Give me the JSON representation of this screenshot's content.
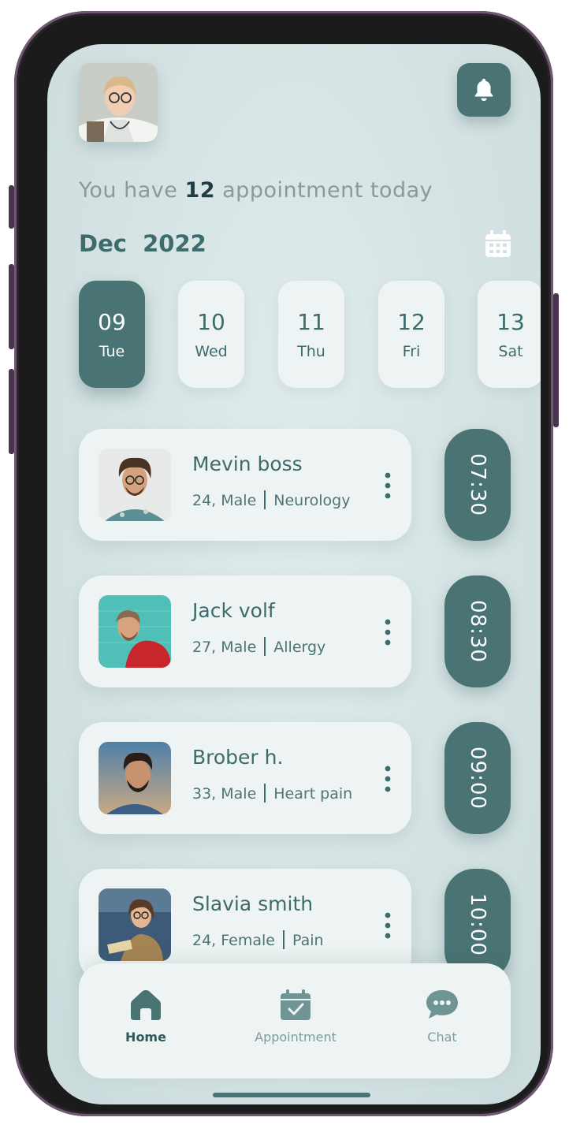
{
  "header": {
    "avatar_label": "doctor avatar",
    "greeting_prefix": "You have",
    "appointment_count": "12",
    "greeting_suffix": "appointment today",
    "month_label": "Dec  2022"
  },
  "days": [
    {
      "num": "09",
      "name": "Tue",
      "selected": true
    },
    {
      "num": "10",
      "name": "Wed",
      "selected": false
    },
    {
      "num": "11",
      "name": "Thu",
      "selected": false
    },
    {
      "num": "12",
      "name": "Fri",
      "selected": false
    },
    {
      "num": "13",
      "name": "Sat",
      "selected": false
    }
  ],
  "appointments": [
    {
      "name": "Mevin boss",
      "age_gender": "24, Male",
      "reason": "Neurology",
      "time": "07:30"
    },
    {
      "name": "Jack volf",
      "age_gender": "27, Male",
      "reason": "Allergy",
      "time": "08:30"
    },
    {
      "name": "Brober h.",
      "age_gender": "33, Male",
      "reason": "Heart pain",
      "time": "09:00"
    },
    {
      "name": "Slavia smith",
      "age_gender": "24, Female",
      "reason": "Pain",
      "time": "10:00"
    }
  ],
  "nav": {
    "home": "Home",
    "appointment": "Appointment",
    "chat": "Chat",
    "active": "home"
  },
  "colors": {
    "accent": "#4a7373",
    "card": "#eef4f4",
    "background": "#d6e4e4",
    "text_primary": "#3e6b6b",
    "text_muted": "#8a9a9b"
  },
  "icons": [
    "bell-icon",
    "calendar-icon",
    "kebab-menu-icon",
    "home-icon",
    "calendar-check-icon",
    "chat-bubble-icon"
  ]
}
